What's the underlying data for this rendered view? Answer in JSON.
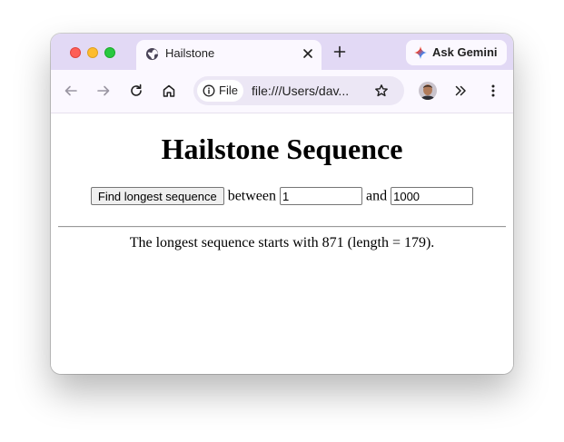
{
  "browser": {
    "tab": {
      "title": "Hailstone"
    },
    "ask_gemini_label": "Ask Gemini",
    "omnibox": {
      "chip_label": "File",
      "url": "file:///Users/dav..."
    }
  },
  "page": {
    "title": "Hailstone Sequence",
    "find_button_label": "Find longest sequence",
    "between_label": "between",
    "and_label": "and",
    "start_value": "1",
    "end_value": "1000",
    "result_text": "The longest sequence starts with 871 (length = 179)."
  },
  "colors": {
    "tabstrip": "#e2d9f5",
    "toolbar": "#fbf8ff",
    "omnibox": "#ece7f5",
    "close": "#fe5f57",
    "minimize": "#febc2e",
    "maximize": "#28c840"
  },
  "icons": [
    "globe-icon",
    "tab-close-icon",
    "new-tab-icon",
    "gemini-spark-icon",
    "back-icon",
    "forward-icon",
    "reload-icon",
    "home-icon",
    "info-icon",
    "bookmark-star-icon",
    "extensions-icon",
    "menu-icon"
  ]
}
